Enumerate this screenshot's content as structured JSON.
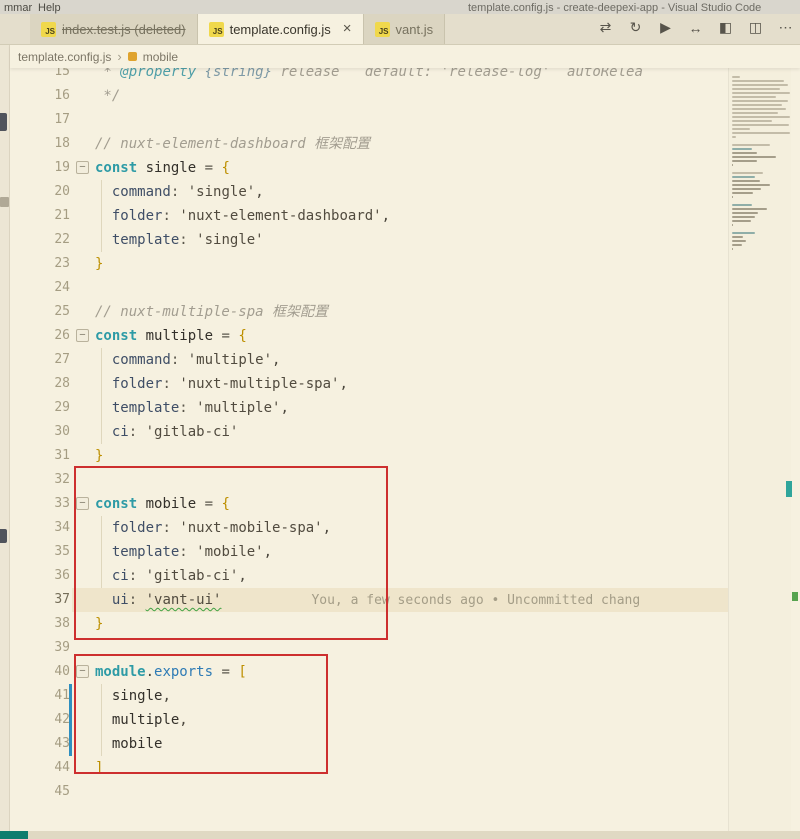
{
  "colors": {
    "accent_teal": "#0E7D6E",
    "annotation_red": "#CD2F2F",
    "js_icon_yellow": "#F0D84C",
    "git_modified_blue": "#2E8FC0"
  },
  "glyphs": {
    "fold": "−",
    "close": "×",
    "js_badge": "JS"
  },
  "title_bar": {
    "menu_items": [
      "mmar",
      "Help"
    ],
    "window_title": "template.config.js - create-deepexi-app - Visual Studio Code"
  },
  "tabs": [
    {
      "label": "index.test.js (deleted)",
      "active": false,
      "deleted": true,
      "close": false
    },
    {
      "label": "template.config.js",
      "active": true,
      "deleted": false,
      "close": true
    },
    {
      "label": "vant.js",
      "active": false,
      "deleted": false,
      "close": false
    }
  ],
  "editor_actions": [
    {
      "name": "open-changes-icon",
      "glyph": "⇄"
    },
    {
      "name": "sync-icon",
      "glyph": "↻"
    },
    {
      "name": "run-icon",
      "glyph": "▶"
    },
    {
      "name": "navigate-back-forward-icon",
      "glyph": "↔"
    },
    {
      "name": "compare-changes-icon",
      "glyph": "◧"
    },
    {
      "name": "split-editor-icon",
      "glyph": "◫"
    },
    {
      "name": "more-actions-icon",
      "glyph": "⋯"
    }
  ],
  "breadcrumb": {
    "file": "template.config.js",
    "separator": "›",
    "symbol": "mobile"
  },
  "gitlens": {
    "blame": "You, a few seconds ago • Uncommitted chang"
  },
  "code": {
    "lines": [
      {
        "n": 15,
        "t": [
          [
            "cm",
            " * "
          ],
          [
            "cmk",
            "@property"
          ],
          [
            "cm",
            " "
          ],
          [
            "cmt",
            "{string}"
          ],
          [
            "cm",
            " release   "
          ],
          [
            "cm",
            "default: 'release-log'  autoRelea"
          ]
        ]
      },
      {
        "n": 16,
        "t": [
          [
            "cm",
            " */"
          ]
        ]
      },
      {
        "n": 17,
        "t": []
      },
      {
        "n": 18,
        "t": [
          [
            "cm",
            "// nuxt-element-dashboard 框架配置"
          ]
        ]
      },
      {
        "n": 19,
        "fold": true,
        "t": [
          [
            "kw",
            "const"
          ],
          [
            "pu",
            " "
          ],
          [
            "id",
            "single"
          ],
          [
            "pu",
            " "
          ],
          [
            "op",
            "="
          ],
          [
            "pu",
            " "
          ],
          [
            "br",
            "{"
          ]
        ]
      },
      {
        "n": 20,
        "t": [
          [
            "pu",
            "  "
          ],
          [
            "pr",
            "command"
          ],
          [
            "op",
            ":"
          ],
          [
            "pu",
            " "
          ],
          [
            "st",
            "'single'"
          ],
          [
            "pu",
            ","
          ]
        ]
      },
      {
        "n": 21,
        "t": [
          [
            "pu",
            "  "
          ],
          [
            "pr",
            "folder"
          ],
          [
            "op",
            ":"
          ],
          [
            "pu",
            " "
          ],
          [
            "st",
            "'nuxt-element-dashboard'"
          ],
          [
            "pu",
            ","
          ]
        ]
      },
      {
        "n": 22,
        "t": [
          [
            "pu",
            "  "
          ],
          [
            "pr",
            "template"
          ],
          [
            "op",
            ":"
          ],
          [
            "pu",
            " "
          ],
          [
            "st",
            "'single'"
          ]
        ]
      },
      {
        "n": 23,
        "t": [
          [
            "br",
            "}"
          ]
        ]
      },
      {
        "n": 24,
        "t": []
      },
      {
        "n": 25,
        "t": [
          [
            "cm",
            "// nuxt-multiple-spa 框架配置"
          ]
        ]
      },
      {
        "n": 26,
        "fold": true,
        "t": [
          [
            "kw",
            "const"
          ],
          [
            "pu",
            " "
          ],
          [
            "id",
            "multiple"
          ],
          [
            "pu",
            " "
          ],
          [
            "op",
            "="
          ],
          [
            "pu",
            " "
          ],
          [
            "br",
            "{"
          ]
        ]
      },
      {
        "n": 27,
        "t": [
          [
            "pu",
            "  "
          ],
          [
            "pr",
            "command"
          ],
          [
            "op",
            ":"
          ],
          [
            "pu",
            " "
          ],
          [
            "st",
            "'multiple'"
          ],
          [
            "pu",
            ","
          ]
        ]
      },
      {
        "n": 28,
        "t": [
          [
            "pu",
            "  "
          ],
          [
            "pr",
            "folder"
          ],
          [
            "op",
            ":"
          ],
          [
            "pu",
            " "
          ],
          [
            "st",
            "'nuxt-multiple-spa'"
          ],
          [
            "pu",
            ","
          ]
        ]
      },
      {
        "n": 29,
        "t": [
          [
            "pu",
            "  "
          ],
          [
            "pr",
            "template"
          ],
          [
            "op",
            ":"
          ],
          [
            "pu",
            " "
          ],
          [
            "st",
            "'multiple'"
          ],
          [
            "pu",
            ","
          ]
        ]
      },
      {
        "n": 30,
        "t": [
          [
            "pu",
            "  "
          ],
          [
            "pr",
            "ci"
          ],
          [
            "op",
            ":"
          ],
          [
            "pu",
            " "
          ],
          [
            "st",
            "'gitlab-ci'"
          ]
        ]
      },
      {
        "n": 31,
        "t": [
          [
            "br",
            "}"
          ]
        ]
      },
      {
        "n": 32,
        "t": []
      },
      {
        "n": 33,
        "fold": true,
        "t": [
          [
            "kw",
            "const"
          ],
          [
            "pu",
            " "
          ],
          [
            "id",
            "mobile"
          ],
          [
            "pu",
            " "
          ],
          [
            "op",
            "="
          ],
          [
            "pu",
            " "
          ],
          [
            "br",
            "{"
          ]
        ]
      },
      {
        "n": 34,
        "t": [
          [
            "pu",
            "  "
          ],
          [
            "pr",
            "folder"
          ],
          [
            "op",
            ":"
          ],
          [
            "pu",
            " "
          ],
          [
            "st",
            "'nuxt-mobile-spa'"
          ],
          [
            "pu",
            ","
          ]
        ]
      },
      {
        "n": 35,
        "t": [
          [
            "pu",
            "  "
          ],
          [
            "pr",
            "template"
          ],
          [
            "op",
            ":"
          ],
          [
            "pu",
            " "
          ],
          [
            "st",
            "'mobile'"
          ],
          [
            "pu",
            ","
          ]
        ]
      },
      {
        "n": 36,
        "t": [
          [
            "pu",
            "  "
          ],
          [
            "pr",
            "ci"
          ],
          [
            "op",
            ":"
          ],
          [
            "pu",
            " "
          ],
          [
            "st",
            "'gitlab-ci'"
          ],
          [
            "pu",
            ","
          ]
        ]
      },
      {
        "n": 37,
        "current": true,
        "t": [
          [
            "pu",
            "  "
          ],
          [
            "pr",
            "ui"
          ],
          [
            "op",
            ":"
          ],
          [
            "pu",
            " "
          ],
          [
            "st sq",
            "'vant-ui'"
          ]
        ]
      },
      {
        "n": 38,
        "t": [
          [
            "br",
            "}"
          ]
        ]
      },
      {
        "n": 39,
        "t": []
      },
      {
        "n": 40,
        "fold": true,
        "t": [
          [
            "kw",
            "module"
          ],
          [
            "pu",
            "."
          ],
          [
            "ex",
            "exports"
          ],
          [
            "pu",
            " "
          ],
          [
            "op",
            "="
          ],
          [
            "pu",
            " "
          ],
          [
            "br",
            "["
          ]
        ]
      },
      {
        "n": 41,
        "git": true,
        "t": [
          [
            "pu",
            "  "
          ],
          [
            "id",
            "single"
          ],
          [
            "pu",
            ","
          ]
        ]
      },
      {
        "n": 42,
        "git": true,
        "t": [
          [
            "pu",
            "  "
          ],
          [
            "id",
            "multiple"
          ],
          [
            "pu",
            ","
          ]
        ]
      },
      {
        "n": 43,
        "git": true,
        "t": [
          [
            "pu",
            "  "
          ],
          [
            "id",
            "mobile"
          ]
        ]
      },
      {
        "n": 44,
        "t": [
          [
            "br",
            "]"
          ]
        ]
      },
      {
        "n": 45,
        "t": []
      }
    ]
  }
}
